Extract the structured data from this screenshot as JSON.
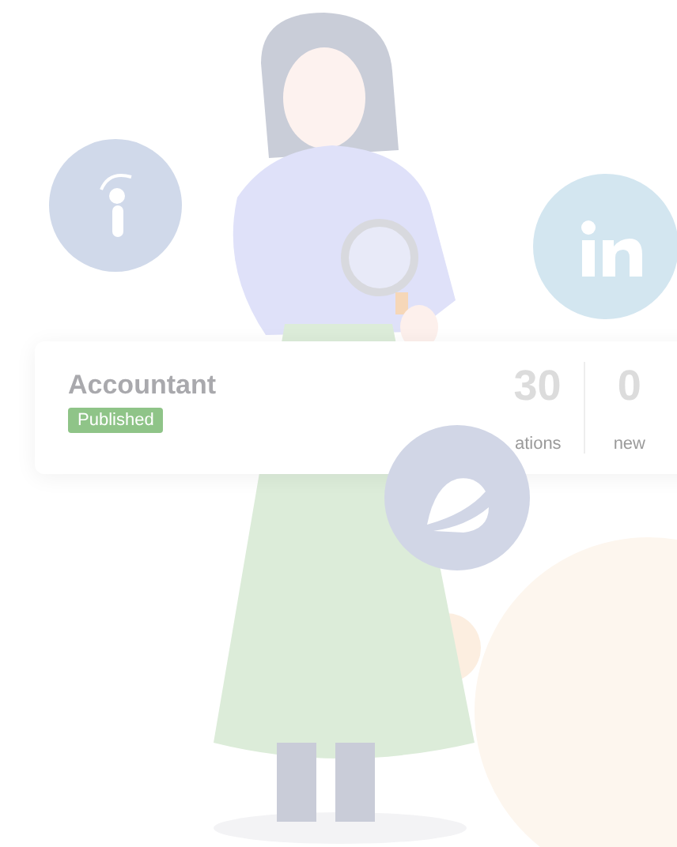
{
  "card": {
    "title": "Accountant",
    "status": "Published",
    "stats": [
      {
        "value": "30",
        "label": "ations"
      },
      {
        "value": "0",
        "label": "new"
      }
    ]
  }
}
